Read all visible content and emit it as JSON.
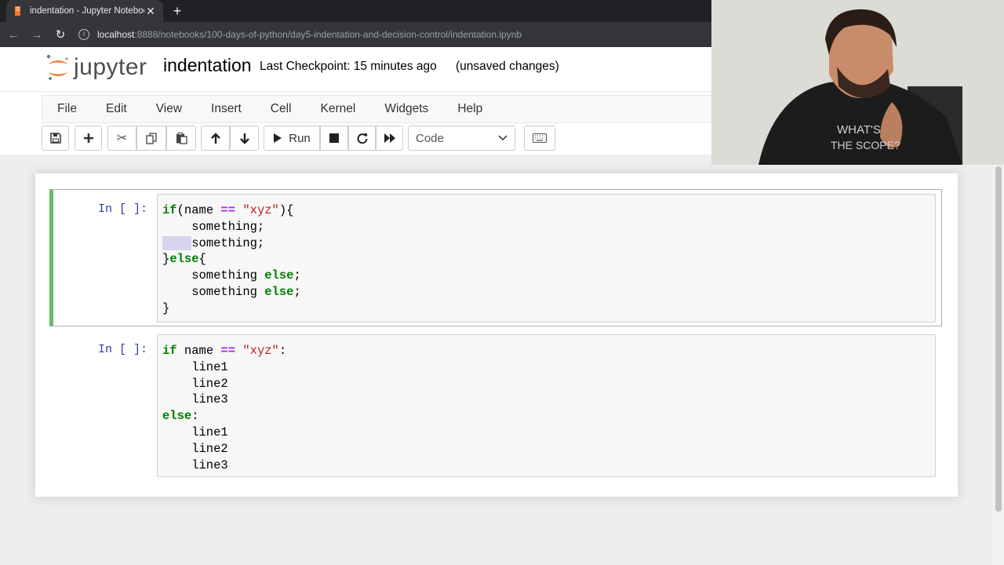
{
  "browser": {
    "tab_title": "indentation - Jupyter Notebook",
    "url_host": "localhost",
    "url_path": ":8888/notebooks/100-days-of-python/day5-indentation-and-decision-control/indentation.ipynb"
  },
  "header": {
    "logo_text": "jupyter",
    "notebook_name": "indentation",
    "checkpoint": "Last Checkpoint: 15 minutes ago",
    "status": "(unsaved changes)"
  },
  "menu": [
    "File",
    "Edit",
    "View",
    "Insert",
    "Cell",
    "Kernel",
    "Widgets",
    "Help"
  ],
  "toolbar": {
    "run_label": "Run",
    "cell_type": "Code"
  },
  "cells": [
    {
      "prompt": "In [ ]:",
      "lines": [
        "if(name == \"xyz\"){",
        "    something;",
        "    something;",
        "}else{",
        "    something else;",
        "    something else;",
        "}"
      ]
    },
    {
      "prompt": "In [ ]:",
      "lines": [
        "if name == \"xyz\":",
        "    line1",
        "    line2",
        "    line3",
        "else:",
        "    line1",
        "    line2",
        "    line3"
      ]
    }
  ],
  "webcam": {
    "shirt_text_line1": "WHAT'S",
    "shirt_text_line2": "THE SCOPE?"
  },
  "colors": {
    "edit_border": "#66bb6a",
    "prompt": "#303f9f",
    "keyword": "#008000",
    "operator": "#aa22ff",
    "string": "#ba2121"
  }
}
